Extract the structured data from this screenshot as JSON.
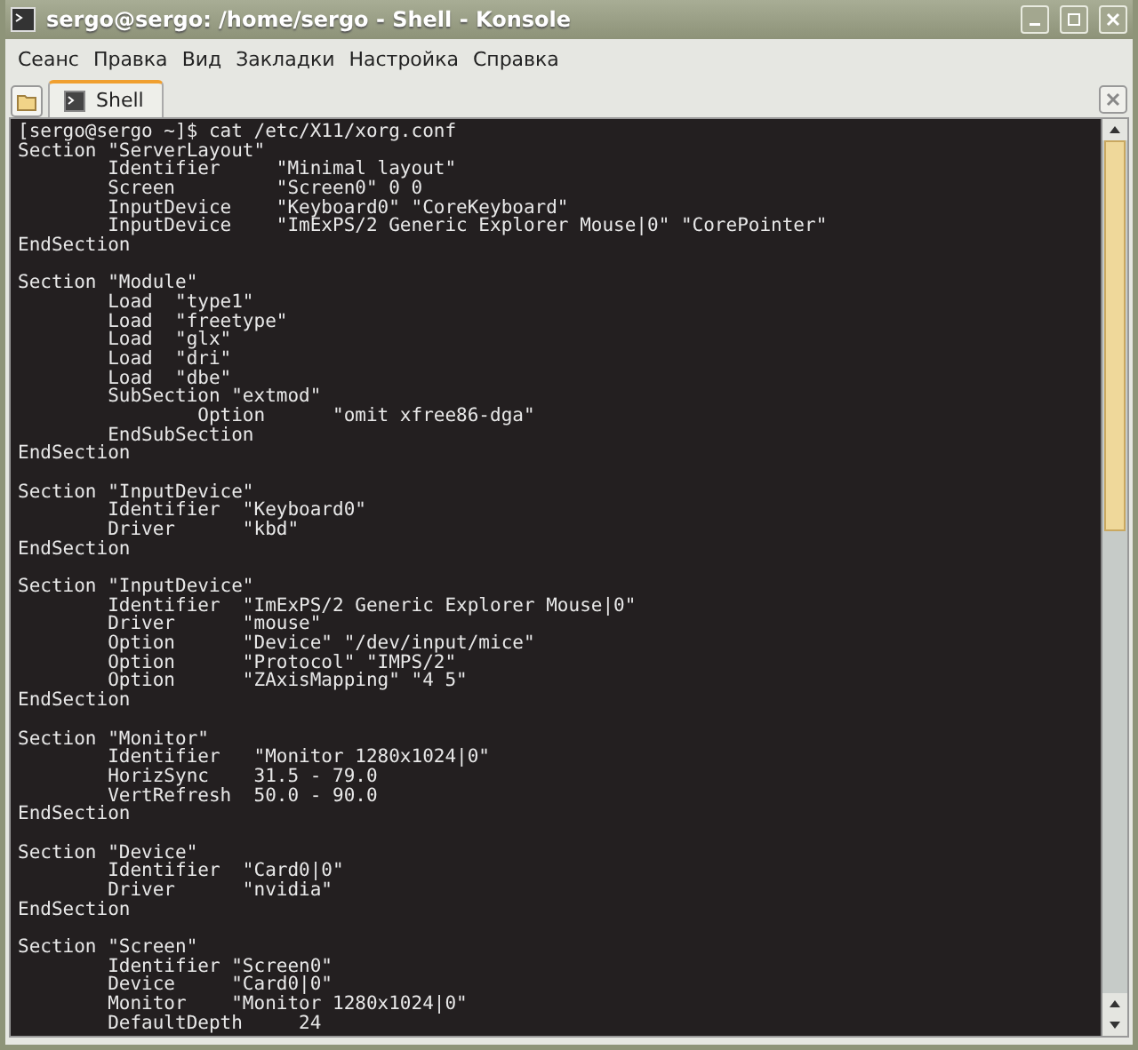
{
  "window": {
    "title": "sergo@sergo: /home/sergo - Shell - Konsole"
  },
  "menu": [
    "Сеанс",
    "Правка",
    "Вид",
    "Закладки",
    "Настройка",
    "Справка"
  ],
  "tabs": [
    {
      "label": "Shell",
      "selected": true
    }
  ],
  "terminal": {
    "blocks": [
      [
        "[sergo@sergo ~]$ cat /etc/X11/xorg.conf",
        "Section \"ServerLayout\"",
        "        Identifier     \"Minimal layout\"",
        "        Screen         \"Screen0\" 0 0",
        "        InputDevice    \"Keyboard0\" \"CoreKeyboard\"",
        "        InputDevice    \"ImExPS/2 Generic Explorer Mouse|0\" \"CorePointer\"",
        "EndSection"
      ],
      [
        "Section \"Module\"",
        "        Load  \"type1\"",
        "        Load  \"freetype\"",
        "        Load  \"glx\"",
        "        Load  \"dri\"",
        "        Load  \"dbe\"",
        "        SubSection \"extmod\"",
        "                Option      \"omit xfree86-dga\"",
        "        EndSubSection",
        "EndSection"
      ],
      [
        "Section \"InputDevice\"",
        "        Identifier  \"Keyboard0\"",
        "        Driver      \"kbd\"",
        "EndSection"
      ],
      [
        "Section \"InputDevice\"",
        "        Identifier  \"ImExPS/2 Generic Explorer Mouse|0\"",
        "        Driver      \"mouse\"",
        "        Option      \"Device\" \"/dev/input/mice\"",
        "        Option      \"Protocol\" \"IMPS/2\"",
        "        Option      \"ZAxisMapping\" \"4 5\"",
        "EndSection"
      ],
      [
        "Section \"Monitor\"",
        "        Identifier   \"Monitor 1280x1024|0\"",
        "        HorizSync    31.5 - 79.0",
        "        VertRefresh  50.0 - 90.0",
        "EndSection"
      ],
      [
        "Section \"Device\"",
        "        Identifier  \"Card0|0\"",
        "        Driver      \"nvidia\"",
        "EndSection"
      ],
      [
        "Section \"Screen\"",
        "        Identifier \"Screen0\"",
        "        Device     \"Card0|0\"",
        "        Monitor    \"Monitor 1280x1024|0\"",
        "        DefaultDepth     24"
      ]
    ]
  }
}
